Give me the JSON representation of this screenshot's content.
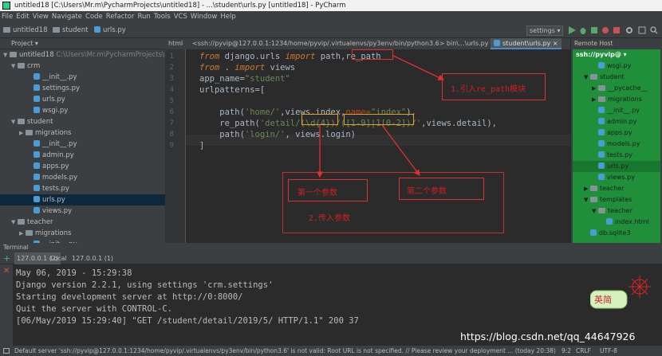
{
  "window": {
    "title": "untitled18 [C:\\Users\\Mr.m\\PycharmProjects\\untitled18] - ...\\student\\urls.py [untitled18] - PyCharm"
  },
  "menu": [
    "File",
    "Edit",
    "View",
    "Navigate",
    "Code",
    "Refactor",
    "Run",
    "Tools",
    "VCS",
    "Window",
    "Help"
  ],
  "breadcrumbs": [
    "untitled18",
    "student",
    "urls.py"
  ],
  "run_config": "settings",
  "tabs": [
    {
      "label": "html"
    },
    {
      "label": "<ssh://pyvip@127.0.0.1:1234/home/pyvip/.virtualenvs/py3env/bin/python3.6> bin\\...\\urls.py"
    },
    {
      "label": "student\\urls.py"
    }
  ],
  "project_panel": {
    "header": "Project",
    "rows": [
      {
        "arrow": "▼",
        "label": "untitled18",
        "path": "C:\\Users\\Mr.m\\PycharmProjects\\untitled18",
        "type": "folder",
        "indent": 0
      },
      {
        "arrow": "▼",
        "label": "crm",
        "path": "",
        "type": "folder",
        "indent": 1
      },
      {
        "arrow": "",
        "label": "__init__.py",
        "path": "",
        "type": "file",
        "indent": 3
      },
      {
        "arrow": "",
        "label": "settings.py",
        "path": "",
        "type": "file",
        "indent": 3
      },
      {
        "arrow": "",
        "label": "urls.py",
        "path": "",
        "type": "file",
        "indent": 3
      },
      {
        "arrow": "",
        "label": "wsgi.py",
        "path": "",
        "type": "file",
        "indent": 3
      },
      {
        "arrow": "▼",
        "label": "student",
        "path": "",
        "type": "folder",
        "indent": 1
      },
      {
        "arrow": "▶",
        "label": "migrations",
        "path": "",
        "type": "folder",
        "indent": 2
      },
      {
        "arrow": "",
        "label": "__init__.py",
        "path": "",
        "type": "file",
        "indent": 3
      },
      {
        "arrow": "",
        "label": "admin.py",
        "path": "",
        "type": "file",
        "indent": 3
      },
      {
        "arrow": "",
        "label": "apps.py",
        "path": "",
        "type": "file",
        "indent": 3
      },
      {
        "arrow": "",
        "label": "models.py",
        "path": "",
        "type": "file",
        "indent": 3
      },
      {
        "arrow": "",
        "label": "tests.py",
        "path": "",
        "type": "file",
        "indent": 3
      },
      {
        "arrow": "",
        "label": "urls.py",
        "path": "",
        "type": "file",
        "indent": 3,
        "selected": true
      },
      {
        "arrow": "",
        "label": "views.py",
        "path": "",
        "type": "file",
        "indent": 3
      },
      {
        "arrow": "▼",
        "label": "teacher",
        "path": "",
        "type": "folder",
        "indent": 1
      },
      {
        "arrow": "▶",
        "label": "migrations",
        "path": "",
        "type": "folder",
        "indent": 2
      },
      {
        "arrow": "",
        "label": "__init__.py",
        "path": "",
        "type": "file",
        "indent": 3
      }
    ]
  },
  "editor": {
    "line_numbers": [
      "1",
      "2",
      "3",
      "4",
      "5",
      "6",
      "7",
      "8",
      "9"
    ],
    "lines": [
      [
        {
          "t": "from",
          "c": "kw"
        },
        {
          "t": " django.urls ",
          "c": ""
        },
        {
          "t": "import",
          "c": "kw"
        },
        {
          "t": " path,re_path",
          "c": ""
        }
      ],
      [
        {
          "t": "from",
          "c": "kw"
        },
        {
          "t": " . ",
          "c": ""
        },
        {
          "t": "import",
          "c": "kw"
        },
        {
          "t": " views",
          "c": ""
        }
      ],
      [
        {
          "t": "app_name=",
          "c": ""
        },
        {
          "t": "\"student\"",
          "c": "str"
        }
      ],
      [
        {
          "t": "urlpatterns=[",
          "c": ""
        }
      ],
      [],
      [
        {
          "t": "    path(",
          "c": ""
        },
        {
          "t": "'home/'",
          "c": "str"
        },
        {
          "t": ",views.index,",
          "c": ""
        },
        {
          "t": "name=",
          "c": "kwa"
        },
        {
          "t": "\"index\"",
          "c": "str"
        },
        {
          "t": "),",
          "c": ""
        }
      ],
      [
        {
          "t": "    re_path(",
          "c": ""
        },
        {
          "t": "'detail/(\\d{4})/([1-9]|1[0-2])/'",
          "c": "str"
        },
        {
          "t": ",views.detail),",
          "c": ""
        }
      ],
      [
        {
          "t": "    path(",
          "c": ""
        },
        {
          "t": "'login/'",
          "c": "str"
        },
        {
          "t": ", views.login)",
          "c": ""
        }
      ],
      [
        {
          "t": "]",
          "c": ""
        }
      ]
    ]
  },
  "annotations": {
    "import_note": "1.引入re_path模块",
    "param1": "第一个参数",
    "param2": "第二个参数",
    "pass_params": "2.传入参数"
  },
  "right_panel": {
    "header": "Remote Host",
    "root": "ssh://pyvip@",
    "rows": [
      {
        "arrow": "",
        "label": "wsgi.py",
        "indent": 2,
        "type": "file"
      },
      {
        "arrow": "▼",
        "label": "student",
        "indent": 1,
        "type": "folder"
      },
      {
        "arrow": "▶",
        "label": "__pycache__",
        "indent": 2,
        "type": "folder"
      },
      {
        "arrow": "▶",
        "label": "migrations",
        "indent": 2,
        "type": "folder"
      },
      {
        "arrow": "",
        "label": "__init__.py",
        "indent": 2,
        "type": "file"
      },
      {
        "arrow": "",
        "label": "admin.py",
        "indent": 2,
        "type": "file"
      },
      {
        "arrow": "",
        "label": "apps.py",
        "indent": 2,
        "type": "file"
      },
      {
        "arrow": "",
        "label": "models.py",
        "indent": 2,
        "type": "file"
      },
      {
        "arrow": "",
        "label": "tests.py",
        "indent": 2,
        "type": "file"
      },
      {
        "arrow": "",
        "label": "urls.py",
        "indent": 2,
        "type": "file",
        "selected": true
      },
      {
        "arrow": "",
        "label": "views.py",
        "indent": 2,
        "type": "file"
      },
      {
        "arrow": "▶",
        "label": "teacher",
        "indent": 1,
        "type": "folder"
      },
      {
        "arrow": "▼",
        "label": "templates",
        "indent": 1,
        "type": "folder"
      },
      {
        "arrow": "▼",
        "label": "teacher",
        "indent": 2,
        "type": "folder"
      },
      {
        "arrow": "",
        "label": "index.html",
        "indent": 3,
        "type": "file"
      },
      {
        "arrow": "",
        "label": "db.sqlite3",
        "indent": 1,
        "type": "file"
      }
    ]
  },
  "terminal": {
    "header": "Terminal",
    "tabs": [
      "127.0.0.1 (2)",
      "Local",
      "127.0.0.1 (1)"
    ],
    "lines": [
      "May 06, 2019 - 15:29:38",
      "Django version 2.2.1, using settings 'crm.settings'",
      "Starting development server at http://0:8000/",
      "Quit the server with CONTROL-C.",
      "[06/May/2019 15:29:40] \"GET /student/detail/2019/5/ HTTP/1.1\" 200 37"
    ]
  },
  "status": {
    "message": "Default server 'ssh://pyvip@127.0.0.1:1234/home/pyvip/.virtualenvs/py3env/bin/python3.6' is not valid: Root URL is not specified. // Please review your deployment ... (today 20:38)",
    "position": "9:2",
    "line_sep": "CRLF",
    "encoding": "UTF-8"
  },
  "watermark": "https://blog.csdn.net/qq_44647926",
  "sticker_text": "英简",
  "colors": {
    "accent": "#4a88c7",
    "annotation": "#e03030",
    "remote_bg": "#1f8f3a"
  }
}
